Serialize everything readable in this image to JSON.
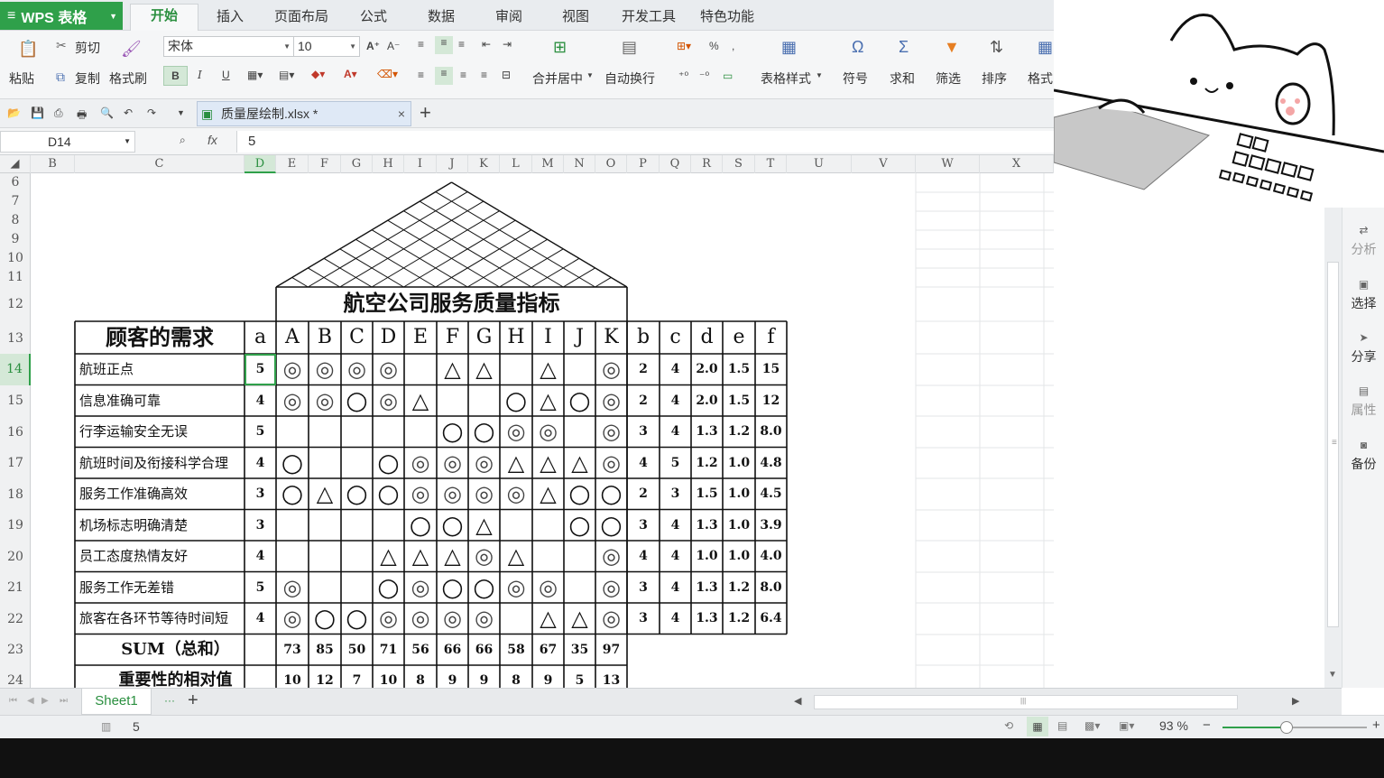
{
  "app": {
    "name": "WPS 表格",
    "tabs": [
      "开始",
      "插入",
      "页面布局",
      "公式",
      "数据",
      "审阅",
      "视图",
      "开发工具",
      "特色功能"
    ],
    "active_tab": "开始"
  },
  "ribbon": {
    "paste": "粘贴",
    "cut": "剪切",
    "copy": "复制",
    "format_painter": "格式刷",
    "font_name": "宋体",
    "font_size": "10",
    "merge_center": "合并居中",
    "wrap_text": "自动换行",
    "table_style": "表格样式",
    "symbol": "符号",
    "sum": "求和",
    "filter": "筛选",
    "sort": "排序",
    "format": "格式",
    "bold": "B",
    "italic": "I",
    "underline": "U",
    "percent": "%"
  },
  "document": {
    "filename": "质量屋绘制.xlsx *"
  },
  "formula_bar": {
    "cell_ref": "D14",
    "fx": "fx",
    "value": "5"
  },
  "columns": [
    "B",
    "C",
    "D",
    "E",
    "F",
    "G",
    "H",
    "I",
    "J",
    "K",
    "L",
    "M",
    "N",
    "O",
    "P",
    "Q",
    "R",
    "S",
    "T",
    "U",
    "V",
    "W",
    "X"
  ],
  "rows": [
    "6",
    "7",
    "8",
    "9",
    "10",
    "11",
    "12",
    "13",
    "14",
    "15",
    "16",
    "17",
    "18",
    "19",
    "20",
    "21",
    "22",
    "23",
    "24"
  ],
  "hoq": {
    "title": "航空公司服务质量指标",
    "requirements_header": "顾客的需求",
    "col_a": "a",
    "tech_cols": [
      "A",
      "B",
      "C",
      "D",
      "E",
      "F",
      "G",
      "H",
      "I",
      "J",
      "K"
    ],
    "right_cols": [
      "b",
      "c",
      "d",
      "e",
      "f"
    ],
    "rows": [
      {
        "need": "航班正点",
        "a": "5",
        "marks": [
          "◎",
          "◎",
          "◎",
          "◎",
          "",
          "△",
          "△",
          "",
          "△",
          "",
          "◎"
        ],
        "b": "2",
        "c": "4",
        "d": "2.0",
        "e": "1.5",
        "f": "15"
      },
      {
        "need": "信息准确可靠",
        "a": "4",
        "marks": [
          "◎",
          "◎",
          "○",
          "◎",
          "△",
          "",
          "",
          "○",
          "△",
          "○",
          "◎"
        ],
        "b": "2",
        "c": "4",
        "d": "2.0",
        "e": "1.5",
        "f": "12"
      },
      {
        "need": "行李运输安全无误",
        "a": "5",
        "marks": [
          "",
          "",
          "",
          "",
          "",
          "○",
          "○",
          "◎",
          "◎",
          "",
          "◎"
        ],
        "b": "3",
        "c": "4",
        "d": "1.3",
        "e": "1.2",
        "f": "8.0"
      },
      {
        "need": "航班时间及衔接科学合理",
        "a": "4",
        "marks": [
          "○",
          "",
          "",
          "○",
          "◎",
          "◎",
          "◎",
          "△",
          "△",
          "△",
          "◎"
        ],
        "b": "4",
        "c": "5",
        "d": "1.2",
        "e": "1.0",
        "f": "4.8"
      },
      {
        "need": "服务工作准确高效",
        "a": "3",
        "marks": [
          "○",
          "△",
          "○",
          "○",
          "◎",
          "◎",
          "◎",
          "◎",
          "△",
          "○",
          "○"
        ],
        "b": "2",
        "c": "3",
        "d": "1.5",
        "e": "1.0",
        "f": "4.5"
      },
      {
        "need": "机场标志明确清楚",
        "a": "3",
        "marks": [
          "",
          "",
          "",
          "",
          "○",
          "○",
          "△",
          "",
          "",
          "○",
          "○"
        ],
        "b": "3",
        "c": "4",
        "d": "1.3",
        "e": "1.0",
        "f": "3.9"
      },
      {
        "need": "员工态度热情友好",
        "a": "4",
        "marks": [
          "",
          "",
          "",
          "△",
          "△",
          "△",
          "◎",
          "△",
          "",
          "",
          "◎"
        ],
        "b": "4",
        "c": "4",
        "d": "1.0",
        "e": "1.0",
        "f": "4.0"
      },
      {
        "need": "服务工作无差错",
        "a": "5",
        "marks": [
          "◎",
          "",
          "",
          "○",
          "◎",
          "○",
          "○",
          "◎",
          "◎",
          "",
          "◎"
        ],
        "b": "3",
        "c": "4",
        "d": "1.3",
        "e": "1.2",
        "f": "8.0"
      },
      {
        "need": "旅客在各环节等待时间短",
        "a": "4",
        "marks": [
          "◎",
          "○",
          "○",
          "◎",
          "◎",
          "◎",
          "◎",
          "",
          "△",
          "△",
          "◎"
        ],
        "b": "3",
        "c": "4",
        "d": "1.3",
        "e": "1.2",
        "f": "6.4"
      }
    ],
    "sum_label": "SUM（总和）",
    "sums": [
      "73",
      "85",
      "50",
      "71",
      "56",
      "66",
      "66",
      "58",
      "67",
      "35",
      "97"
    ],
    "rel_label": "重要性的相对值",
    "rel_values": [
      "10",
      "12",
      "7",
      "10",
      "8",
      "9",
      "9",
      "8",
      "9",
      "5",
      "13"
    ]
  },
  "side_panel": [
    {
      "label": "分析",
      "enabled": false
    },
    {
      "label": "选择",
      "enabled": true
    },
    {
      "label": "分享",
      "enabled": true
    },
    {
      "label": "属性",
      "enabled": false
    },
    {
      "label": "备份",
      "enabled": true
    }
  ],
  "sheets": {
    "active": "Sheet1"
  },
  "status": {
    "value": "5",
    "zoom": "93 %"
  },
  "colors": {
    "accent": "#2fa04a"
  }
}
